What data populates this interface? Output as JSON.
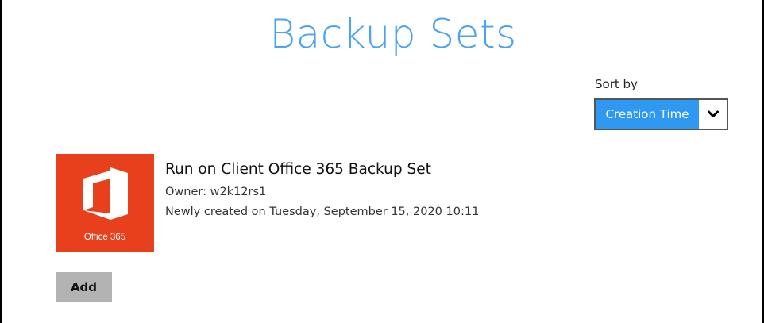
{
  "page": {
    "title": "Backup Sets"
  },
  "sort": {
    "label": "Sort by",
    "selected": "Creation Time"
  },
  "backup_sets": [
    {
      "icon": "office365-icon",
      "icon_label": "Office 365",
      "name": "Run on Client Office 365 Backup Set",
      "owner": "Owner: w2k12rs1",
      "created": "Newly created on Tuesday, September 15, 2020 10:11"
    }
  ],
  "actions": {
    "add_label": "Add"
  },
  "colors": {
    "title": "#4aa3f0",
    "select_accent": "#2f98f3",
    "office365_tile": "#e8401c",
    "add_button": "#b3b3b3"
  }
}
